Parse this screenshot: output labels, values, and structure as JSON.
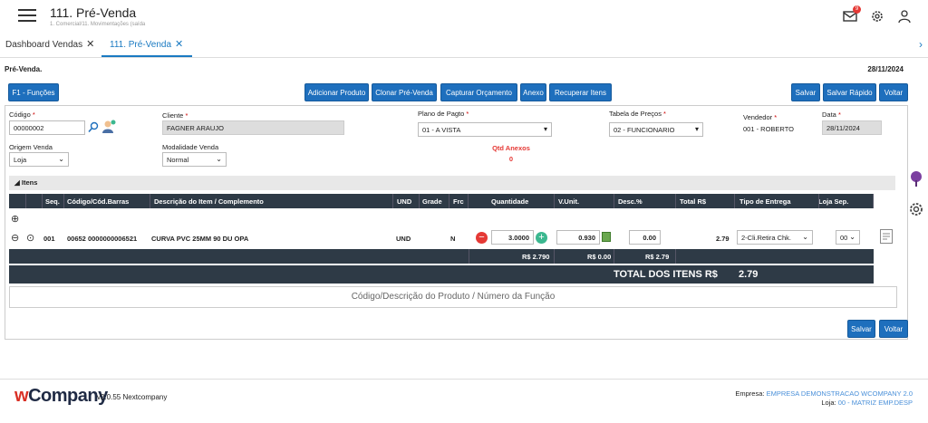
{
  "header": {
    "title": "111. Pré-Venda",
    "breadcrumb": "1. Comercial/11. Movimentações (saída",
    "notification_count": "9"
  },
  "tabs": [
    {
      "label": "Dashboard Vendas",
      "close": "✕"
    },
    {
      "label": "111. Pré-Venda",
      "close": "✕"
    }
  ],
  "page": {
    "heading": "Pré-Venda.",
    "date": "28/11/2024"
  },
  "toolbar": {
    "f1": "F1 - Funções",
    "add_product": "Adicionar Produto",
    "clone": "Clonar Pré-Venda",
    "capture": "Capturar Orçamento",
    "attach": "Anexo",
    "recover": "Recuperar Itens",
    "save": "Salvar",
    "save_quick": "Salvar Rápido",
    "back": "Voltar"
  },
  "form": {
    "codigo_label": "Código",
    "codigo_value": "00000002",
    "cliente_label": "Cliente",
    "cliente_value": "FAGNER ARAUJO",
    "plano_label": "Plano de Pagto",
    "plano_value": "01 - A VISTA",
    "tabela_label": "Tabela de Preços",
    "tabela_value": "02 - FUNCIONARIO",
    "vendedor_label": "Vendedor",
    "vendedor_value": "001 - ROBERTO",
    "data_label": "Data",
    "data_value": "28/11/2024",
    "origem_label": "Origem Venda",
    "origem_value": "Loja",
    "modalidade_label": "Modalidade Venda",
    "modalidade_value": "Normal",
    "anexos_label": "Qtd Anexos",
    "anexos_value": "0",
    "req_mark": "*"
  },
  "items": {
    "section_title": "Itens",
    "columns": [
      "Seq.",
      "Código/Cód.Barras",
      "Descrição do Item / Complemento",
      "UND",
      "Grade",
      "Frc",
      "Quantidade",
      "V.Unit.",
      "Desc.%",
      "Total R$",
      "Tipo de Entrega",
      "Loja Sep."
    ],
    "rows": [
      {
        "seq": "001",
        "code": "00652 0000000006521",
        "description": "CURVA PVC 25MM 90 DU OPA",
        "und": "UND",
        "frc": "N",
        "qty": "3.0000",
        "unit": "0.930",
        "disc": "0.00",
        "total": "2.79",
        "delivery": "2-Cli.Retira Chk.",
        "store": "00"
      }
    ],
    "sum_qty": "R$ 2.790",
    "sum_unit": "R$ 0.00",
    "sum_total": "R$ 2.79",
    "grand_label": "TOTAL DOS ITENS R$",
    "grand_value": "2.79",
    "search_placeholder": "Código/Descrição do Produto / Número da Função"
  },
  "bottom": {
    "save": "Salvar",
    "back": "Voltar"
  },
  "footer": {
    "logo_w": "w",
    "logo_rest": "Company",
    "version": "v2.0.55 Nextcompany",
    "empresa_label": "Empresa:",
    "empresa_value": "EMPRESA DEMONSTRACAO WCOMPANY 2.0",
    "loja_label": "Loja:",
    "loja_value": "00 - MATRIZ EMP.DESP"
  },
  "colors": {
    "primary": "#1e6fbd",
    "grid_dark": "#2e3a46",
    "danger": "#e53935",
    "success": "#3bb78f"
  },
  "icons": [
    "hamburger-icon",
    "mail-icon",
    "gear-icon",
    "user-icon",
    "search-icon",
    "user-add-icon",
    "calculator-icon",
    "note-icon"
  ]
}
